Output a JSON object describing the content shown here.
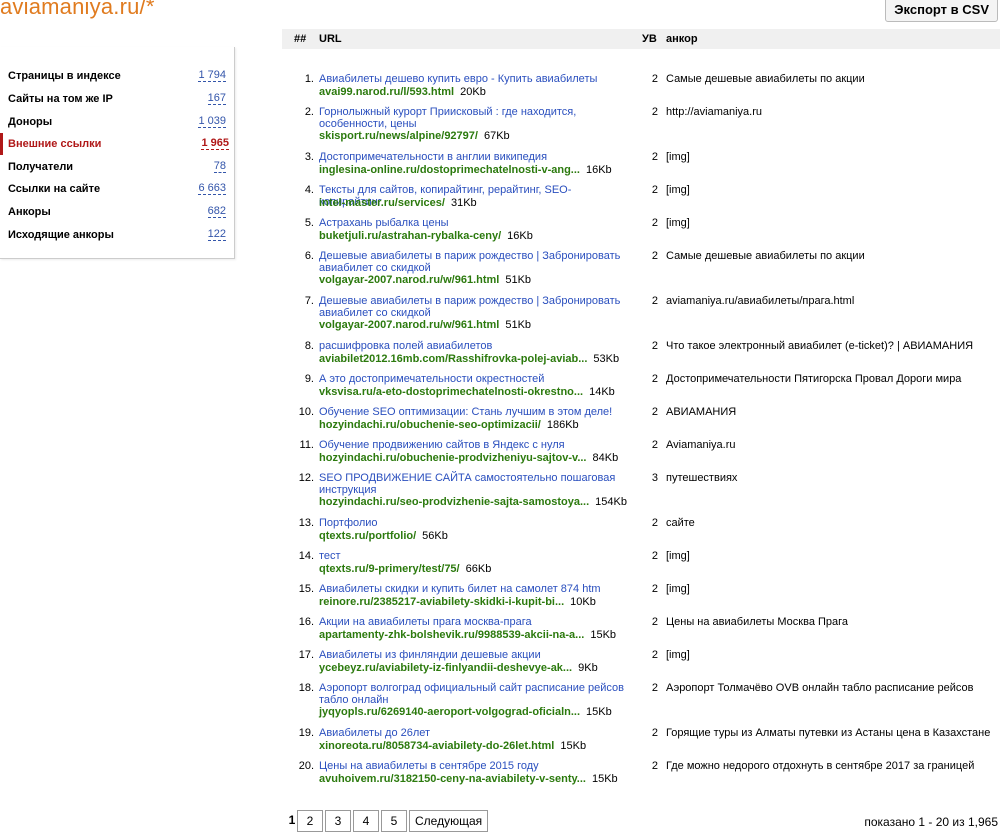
{
  "header": {
    "site_title": "aviamaniya.ru/*",
    "export_label": "Экспорт в CSV"
  },
  "sidebar": {
    "items": [
      {
        "label": "Страницы в индексе",
        "value": "1 794"
      },
      {
        "label": "Сайты на том же IP",
        "value": "167"
      },
      {
        "label": "Доноры",
        "value": "1 039"
      },
      {
        "label": "Внешние ссылки",
        "value": "1 965",
        "active": true
      },
      {
        "label": "Получатели",
        "value": "78"
      },
      {
        "label": "Ссылки на сайте",
        "value": "6 663"
      },
      {
        "label": "Анкоры",
        "value": "682"
      },
      {
        "label": "Исходящие анкоры",
        "value": "122"
      }
    ]
  },
  "table": {
    "headers": {
      "num": "##",
      "url": "URL",
      "level": "УВ",
      "anchor": "анкор"
    },
    "rows": [
      {
        "num": "1.",
        "title": "Авиабилеты дешево купить евро - Купить авиабилеты",
        "url": "avai99.narod.ru/l/593.html",
        "size": "20Kb",
        "level": "2",
        "anchor": "Самые дешевые авиабилеты по акции"
      },
      {
        "num": "2.",
        "title": "Горнолыжный курорт Прииcковый : где находится, особенности, цены",
        "url": "skisport.ru/news/alpine/92797/",
        "size": "67Kb",
        "level": "2",
        "anchor": "http://aviamaniya.ru"
      },
      {
        "num": "3.",
        "title": "Достопримечательности в англии википедия",
        "url": "inglesina-online.ru/dostoprimechatelnosti-v-ang...",
        "size": "16Kb",
        "level": "2",
        "anchor": "[img]"
      },
      {
        "num": "4.",
        "title": "Тексты для сайтов, копирайтинг, рерайтинг, SEO-копирайтинг",
        "url": "intel-master.ru/services/",
        "size": "31Kb",
        "level": "2",
        "anchor": "[img]"
      },
      {
        "num": "5.",
        "title": "Астрахань рыбалка цены",
        "url": "buketjuli.ru/astrahan-rybalka-ceny/",
        "size": "16Kb",
        "level": "2",
        "anchor": "[img]"
      },
      {
        "num": "6.",
        "title": "Дешевые авиабилеты в париж рождество | Забронировать авиабилет со скидкой",
        "url": "volgayar-2007.narod.ru/w/961.html",
        "size": "51Kb",
        "level": "2",
        "anchor": "Самые дешевые авиабилеты по акции"
      },
      {
        "num": "7.",
        "title": "Дешевые авиабилеты в париж рождество | Забронировать авиабилет со скидкой",
        "url": "volgayar-2007.narod.ru/w/961.html",
        "size": "51Kb",
        "level": "2",
        "anchor": "aviamaniya.ru/авиабилеты/прага.html"
      },
      {
        "num": "8.",
        "title": "расшифровка полей авиабилетов",
        "url": "aviabilet2012.16mb.com/Rasshifrovka-polej-aviab...",
        "size": "53Kb",
        "level": "2",
        "anchor": "Что такое электронный авиабилет (e-ticket)? | АВИАМАНИЯ"
      },
      {
        "num": "9.",
        "title": "А это достопримечательности окрестностей",
        "url": "vksvisa.ru/a-eto-dostoprimechatelnosti-okrestno...",
        "size": "14Kb",
        "level": "2",
        "anchor": "Достопримечательности Пятигорска Провал Дороги мира"
      },
      {
        "num": "10.",
        "title": "Обучение SEO оптимизации: Стань лучшим в этом деле!",
        "url": "hozyindachi.ru/obuchenie-seo-optimizacii/",
        "size": "186Kb",
        "level": "2",
        "anchor": "АВИАМАНИЯ"
      },
      {
        "num": "11.",
        "title": "Обучение продвижению сайтов в Яндекс с нуля",
        "url": "hozyindachi.ru/obuchenie-prodvizheniyu-sajtov-v...",
        "size": "84Kb",
        "level": "2",
        "anchor": "Aviamaniya.ru"
      },
      {
        "num": "12.",
        "title": "SEO ПРОДВИЖЕНИЕ САЙТА самостоятельно пошаговая инструкция",
        "url": "hozyindachi.ru/seo-prodvizhenie-sajta-samostoya...",
        "size": "154Kb",
        "level": "3",
        "anchor": "путешествиях"
      },
      {
        "num": "13.",
        "title": "Портфолио",
        "url": "qtexts.ru/portfolio/",
        "size": "56Kb",
        "level": "2",
        "anchor": "сайте"
      },
      {
        "num": "14.",
        "title": "тест",
        "url": "qtexts.ru/9-primery/test/75/",
        "size": "66Kb",
        "level": "2",
        "anchor": "[img]"
      },
      {
        "num": "15.",
        "title": "Авиабилеты скидки и купить билет на самолет 874 htm",
        "url": "reinore.ru/2385217-aviabilety-skidki-i-kupit-bi...",
        "size": "10Kb",
        "level": "2",
        "anchor": "[img]"
      },
      {
        "num": "16.",
        "title": "Акции на авиабилеты прага москва-прага",
        "url": "apartamenty-zhk-bolshevik.ru/9988539-akcii-na-a...",
        "size": "15Kb",
        "level": "2",
        "anchor": "Цены на авиабилеты Москва Прага"
      },
      {
        "num": "17.",
        "title": "Авиабилеты из финляндии дешевые акции",
        "url": "ycebeyz.ru/aviabilety-iz-finlyandii-deshevye-ak...",
        "size": "9Kb",
        "level": "2",
        "anchor": "[img]"
      },
      {
        "num": "18.",
        "title": "Аэропорт волгоград официальный сайт расписание рейсов табло онлайн",
        "url": "jyqyopls.ru/6269140-aeroport-volgograd-oficialn...",
        "size": "15Kb",
        "level": "2",
        "anchor": "Аэропорт Толмачёво OVB онлайн табло расписание рейсов"
      },
      {
        "num": "19.",
        "title": "Авиабилеты до 26лет",
        "url": "xinoreota.ru/8058734-aviabilety-do-26let.html",
        "size": "15Kb",
        "level": "2",
        "anchor": "Горящие туры из Алматы путевки из Астаны цена в Казахстане"
      },
      {
        "num": "20.",
        "title": "Цены на авиабилеты в сентябре 2015 году",
        "url": "avuhoivem.ru/3182150-ceny-na-aviabilety-v-senty...",
        "size": "15Kb",
        "level": "2",
        "anchor": "Где можно недорого отдохнуть в сентябре 2017 за границей"
      }
    ]
  },
  "pagination": {
    "pages": [
      "1",
      "2",
      "3",
      "4",
      "5"
    ],
    "current": "1",
    "next_label": "Следующая",
    "summary": "показано 1 - 20 из 1,965"
  }
}
